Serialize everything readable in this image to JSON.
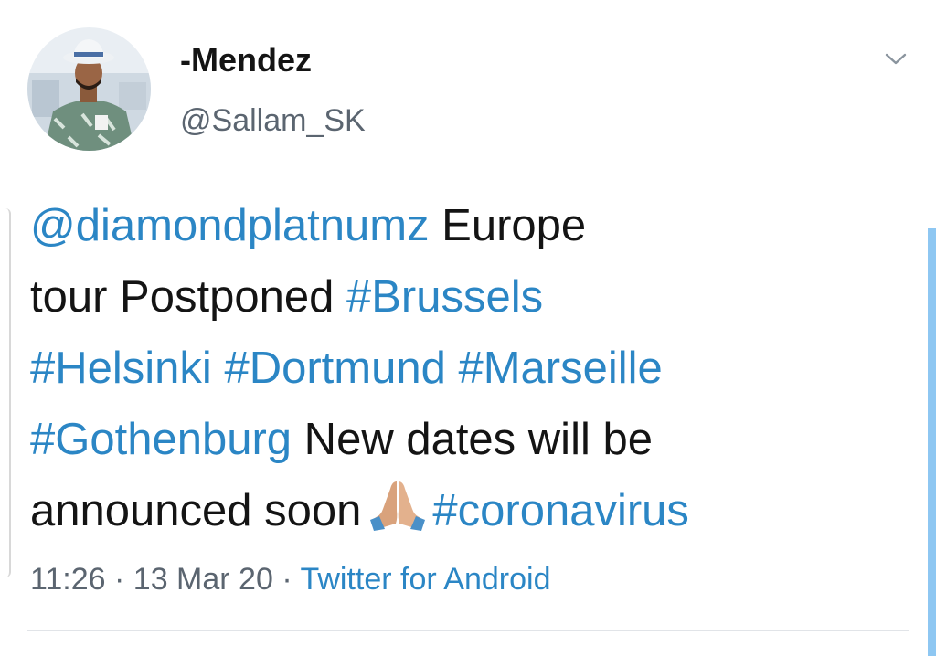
{
  "author": {
    "name": "-Mendez",
    "handle": "@Sallam_SK"
  },
  "tweet": {
    "lines": [
      [
        {
          "text": "@diamondplatnumz",
          "kind": "mention"
        },
        {
          "text": " Europe",
          "kind": "plain"
        }
      ],
      [
        {
          "text": "tour Postponed ",
          "kind": "plain"
        },
        {
          "text": "#Brussels",
          "kind": "hashtag"
        }
      ],
      [
        {
          "text": "#Helsinki",
          "kind": "hashtag"
        },
        {
          "text": " ",
          "kind": "plain"
        },
        {
          "text": "#Dortmund",
          "kind": "hashtag"
        },
        {
          "text": " ",
          "kind": "plain"
        },
        {
          "text": "#Marseille",
          "kind": "hashtag"
        }
      ],
      [
        {
          "text": "#Gothenburg",
          "kind": "hashtag"
        },
        {
          "text": " New dates will be",
          "kind": "plain"
        }
      ],
      [
        {
          "text": "announced soon",
          "kind": "plain"
        },
        {
          "text": "folded-hands-emoji",
          "kind": "emoji"
        },
        {
          "text": "#coronavirus",
          "kind": "hashtag"
        }
      ]
    ]
  },
  "meta": {
    "time": "11:26",
    "separator": " · ",
    "date": "13 Mar 20",
    "source": "Twitter for Android"
  },
  "icons": {
    "menu": "chevron-down-icon",
    "emoji": "folded-hands-icon"
  },
  "colors": {
    "link": "#2b86c5",
    "text": "#141414",
    "muted": "#5b6570",
    "scrollbar": "#8ec7f2"
  }
}
